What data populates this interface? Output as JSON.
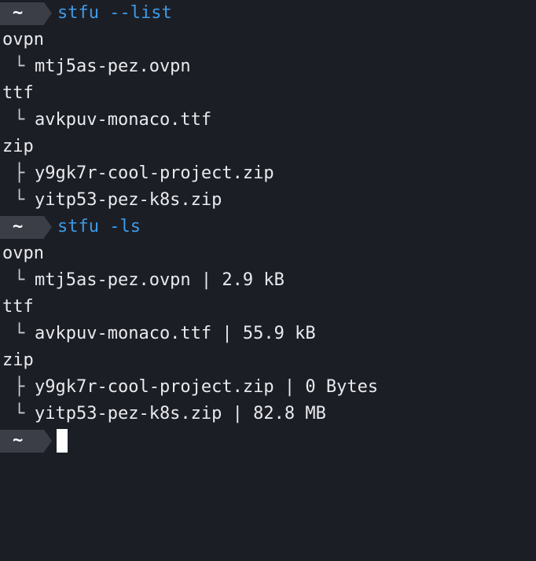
{
  "prompt_symbol": "~",
  "commands": [
    {
      "text": "stfu --list"
    },
    {
      "text": "stfu -ls"
    }
  ],
  "list_output": [
    {
      "category": "ovpn",
      "items": [
        {
          "branch": "└",
          "text": "mtj5as-pez.ovpn"
        }
      ]
    },
    {
      "category": "ttf",
      "items": [
        {
          "branch": "└",
          "text": "avkpuv-monaco.ttf"
        }
      ]
    },
    {
      "category": "zip",
      "items": [
        {
          "branch": "├",
          "text": "y9gk7r-cool-project.zip"
        },
        {
          "branch": "└",
          "text": "yitp53-pez-k8s.zip"
        }
      ]
    }
  ],
  "ls_output": [
    {
      "category": "ovpn",
      "items": [
        {
          "branch": "└",
          "text": "mtj5as-pez.ovpn | 2.9 kB"
        }
      ]
    },
    {
      "category": "ttf",
      "items": [
        {
          "branch": "└",
          "text": "avkpuv-monaco.ttf | 55.9 kB"
        }
      ]
    },
    {
      "category": "zip",
      "items": [
        {
          "branch": "├",
          "text": "y9gk7r-cool-project.zip | 0 Bytes"
        },
        {
          "branch": "└",
          "text": "yitp53-pez-k8s.zip | 82.8 MB"
        }
      ]
    }
  ],
  "colors": {
    "background": "#1c1e25",
    "prompt_badge": "#3b3e47",
    "command": "#3b9be9",
    "text": "#e9eaee"
  }
}
